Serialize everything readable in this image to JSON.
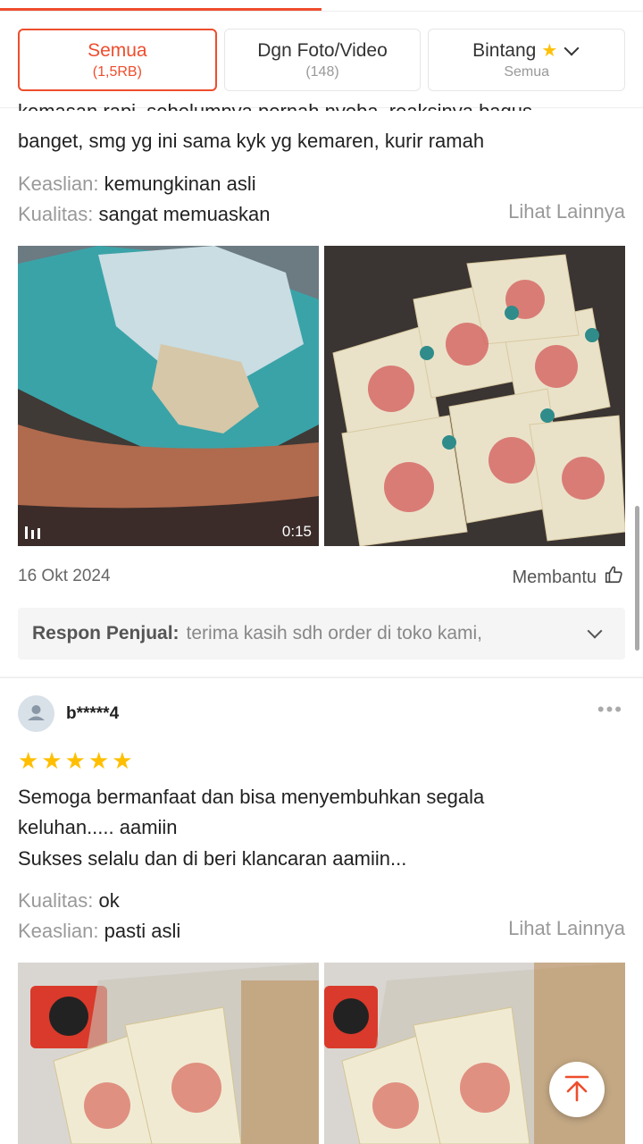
{
  "filters": [
    {
      "label": "Semua",
      "sub": "(1,5RB)",
      "active": true
    },
    {
      "label": "Dgn Foto/Video",
      "sub": "(148)",
      "active": false
    },
    {
      "label": "Bintang",
      "sub": "Semua",
      "active": false
    }
  ],
  "review1": {
    "text_cut": "kemasan rapi, sebelumnya pernah nyoba, reaksinya bagus",
    "text_line2": "banget, smg yg ini sama kyk yg kemaren, kurir ramah",
    "attrs": [
      {
        "key": "Keaslian:",
        "value": "kemungkinan asli"
      },
      {
        "key": "Kualitas:",
        "value": "sangat memuaskan"
      }
    ],
    "more_label": "Lihat Lainnya",
    "video_duration": "0:15",
    "date": "16 Okt 2024",
    "helpful_label": "Membantu",
    "seller_key": "Respon Penjual:",
    "seller_value": "terima kasih sdh order di toko kami,"
  },
  "review2": {
    "username": "b*****4",
    "rating": 5,
    "text_lines": [
      "Semoga bermanfaat dan bisa menyembuhkan segala",
      "keluhan..... aamiin",
      "Sukses selalu dan di beri klancaran aamiin..."
    ],
    "attrs": [
      {
        "key": "Kualitas:",
        "value": "ok"
      },
      {
        "key": "Keaslian:",
        "value": "pasti asli"
      }
    ],
    "more_label": "Lihat Lainnya"
  },
  "colors": {
    "accent": "#ee4d2d",
    "star": "#ffbf00"
  },
  "icons": {
    "thumb": "thumbs-up-icon",
    "scroll_top": "arrow-up-to-top-icon"
  }
}
